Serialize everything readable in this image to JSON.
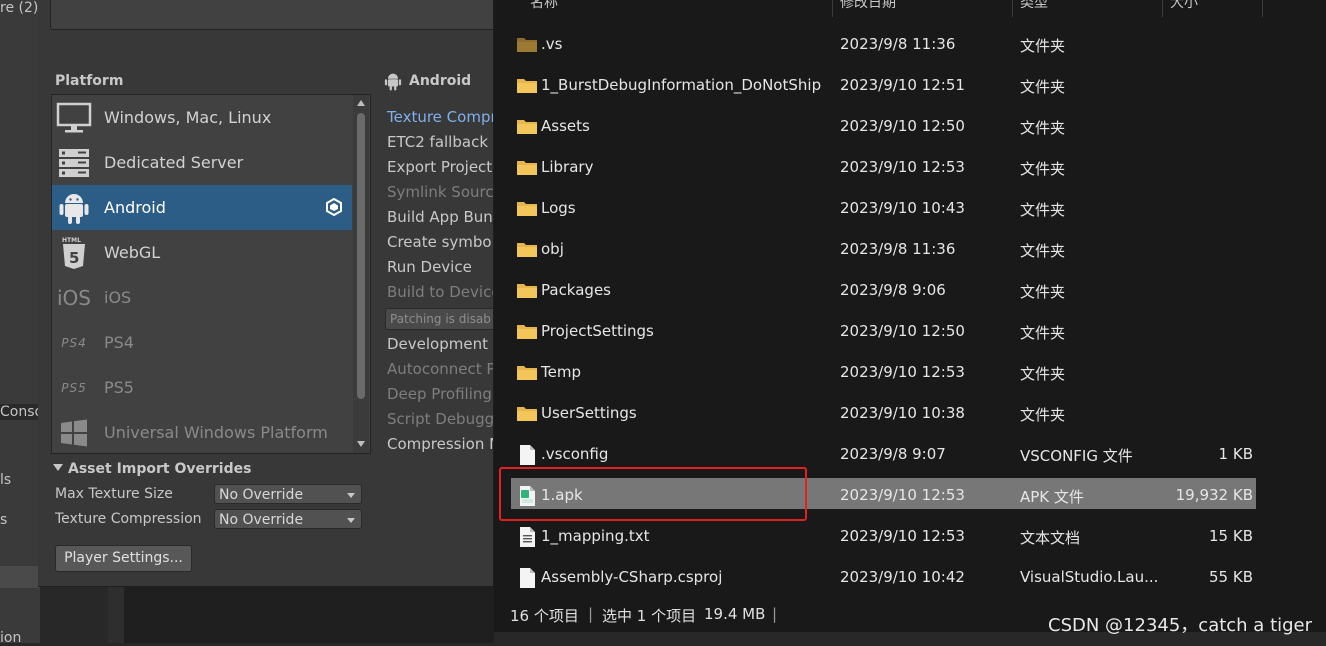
{
  "unity_left": {
    "frag_top": "re (2)",
    "frag_console": "Conso",
    "frag_ls": "ls",
    "frag_s": "s",
    "frag_ion": "ion"
  },
  "build": {
    "platform_label": "Platform",
    "platforms": [
      {
        "label": "Windows, Mac, Linux",
        "icon": "monitor-icon"
      },
      {
        "label": "Dedicated Server",
        "icon": "server-icon"
      },
      {
        "label": "Android",
        "icon": "android-icon"
      },
      {
        "label": "WebGL",
        "icon": "html5-icon"
      },
      {
        "label": "iOS",
        "icon": "ios-icon",
        "icon_text": "iOS"
      },
      {
        "label": "PS4",
        "icon": "ps4-icon",
        "icon_text": "PS4"
      },
      {
        "label": "PS5",
        "icon": "ps5-icon",
        "icon_text": "PS5"
      },
      {
        "label": "Universal Windows Platform",
        "icon": "windows-icon"
      }
    ],
    "selected_platform": "Android",
    "section_title": "Android",
    "options": [
      "Texture Compr",
      "ETC2 fallback",
      "Export Project",
      "Symlink Source",
      "Build App Bund",
      "Create symbols",
      "Run Device",
      "Build to Device",
      "Patching is disab",
      "Development B",
      "Autoconnect P",
      "Deep Profiling",
      "Script Debuggi",
      "Compression M"
    ],
    "overrides_title": "Asset Import Overrides",
    "max_texture_label": "Max Texture Size",
    "max_texture_value": "No Override",
    "texture_comp_label": "Texture Compression",
    "texture_comp_value": "No Override",
    "player_settings": "Player Settings..."
  },
  "explorer": {
    "columns": {
      "name": "名称",
      "date": "修改日期",
      "type": "类型",
      "size": "大小"
    },
    "rows": [
      {
        "name": ".vs",
        "date": "2023/9/8 11:36",
        "type": "文件夹",
        "size": "",
        "icon": "folder-dark-icon"
      },
      {
        "name": "1_BurstDebugInformation_DoNotShip",
        "date": "2023/9/10 12:51",
        "type": "文件夹",
        "size": "",
        "icon": "folder-icon"
      },
      {
        "name": "Assets",
        "date": "2023/9/10 12:50",
        "type": "文件夹",
        "size": "",
        "icon": "folder-icon"
      },
      {
        "name": "Library",
        "date": "2023/9/10 12:53",
        "type": "文件夹",
        "size": "",
        "icon": "folder-icon"
      },
      {
        "name": "Logs",
        "date": "2023/9/10 10:43",
        "type": "文件夹",
        "size": "",
        "icon": "folder-icon"
      },
      {
        "name": "obj",
        "date": "2023/9/8 11:36",
        "type": "文件夹",
        "size": "",
        "icon": "folder-icon"
      },
      {
        "name": "Packages",
        "date": "2023/9/8 9:06",
        "type": "文件夹",
        "size": "",
        "icon": "folder-icon"
      },
      {
        "name": "ProjectSettings",
        "date": "2023/9/10 12:50",
        "type": "文件夹",
        "size": "",
        "icon": "folder-icon"
      },
      {
        "name": "Temp",
        "date": "2023/9/10 12:53",
        "type": "文件夹",
        "size": "",
        "icon": "folder-icon"
      },
      {
        "name": "UserSettings",
        "date": "2023/9/10 10:38",
        "type": "文件夹",
        "size": "",
        "icon": "folder-icon"
      },
      {
        "name": ".vsconfig",
        "date": "2023/9/8 9:07",
        "type": "VSCONFIG 文件",
        "size": "1 KB",
        "icon": "file-icon"
      },
      {
        "name": "1.apk",
        "date": "2023/9/10 12:53",
        "type": "APK 文件",
        "size": "19,932 KB",
        "icon": "apk-icon",
        "selected": true
      },
      {
        "name": "1_mapping.txt",
        "date": "2023/9/10 12:53",
        "type": "文本文档",
        "size": "15 KB",
        "icon": "text-file-icon"
      },
      {
        "name": "Assembly-CSharp.csproj",
        "date": "2023/9/10 10:42",
        "type": "VisualStudio.Lau...",
        "size": "55 KB",
        "icon": "file-icon"
      }
    ],
    "status": {
      "count": "16 个项目",
      "selected": "选中 1 个项目",
      "selsize": "19.4 MB",
      "sep": "|"
    }
  },
  "watermark": "CSDN @12345，catch a tiger",
  "colors": {
    "unity_selected": "#2c5d87",
    "highlight_box": "#e52020",
    "folder": "#e8b54a"
  }
}
